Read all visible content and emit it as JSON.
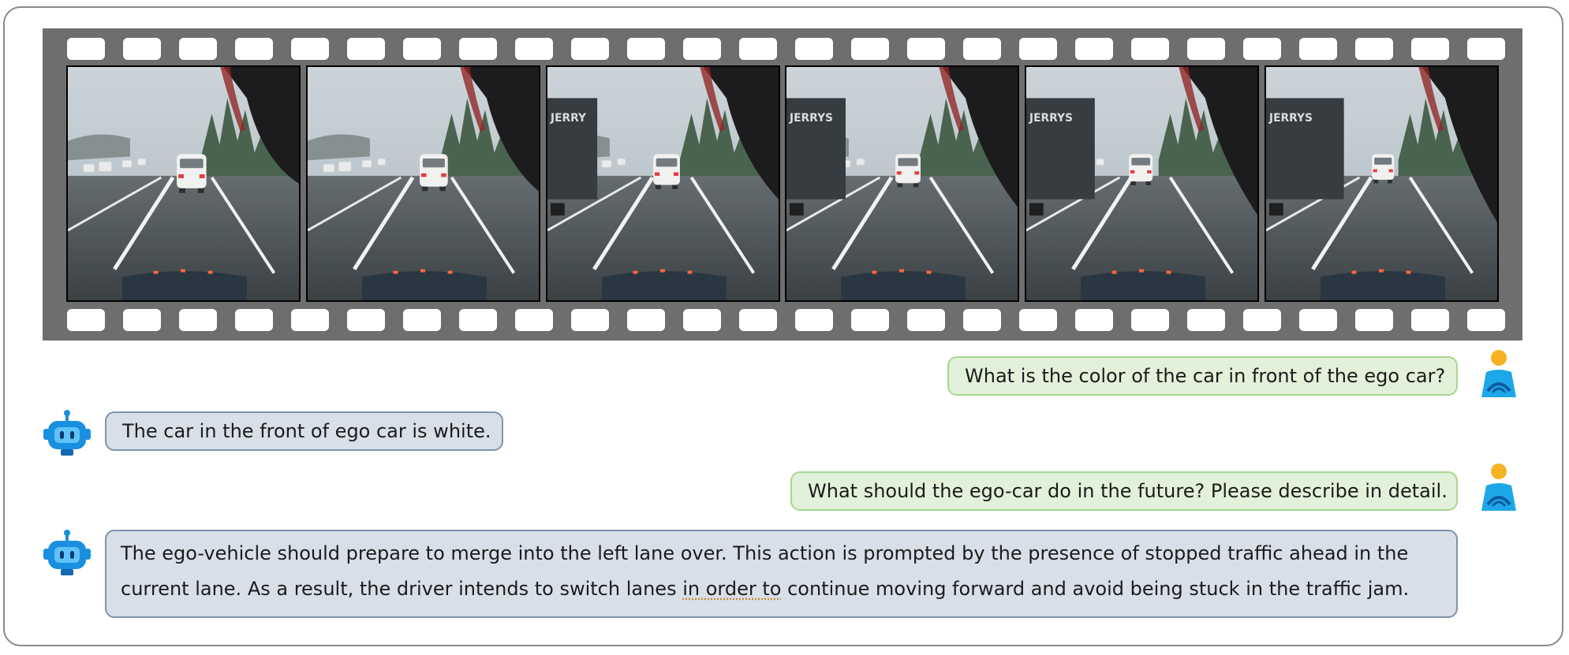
{
  "film": {
    "frame_count": 6,
    "frames": [
      {
        "alt": "dashcam-frame-1"
      },
      {
        "alt": "dashcam-frame-2"
      },
      {
        "alt": "dashcam-frame-3"
      },
      {
        "alt": "dashcam-frame-4"
      },
      {
        "alt": "dashcam-frame-5"
      },
      {
        "alt": "dashcam-frame-6"
      }
    ],
    "truck_text": "JERRYS"
  },
  "colors": {
    "user_bubble_bg": "#e2f1d9",
    "user_bubble_border": "#a7d78e",
    "bot_bubble_bg": "#d8dfe9",
    "bot_bubble_border": "#7e93ad",
    "user_avatar_head": "#f5b323",
    "user_avatar_body": "#1ea7e8",
    "bot_avatar": "#1a8fe0"
  },
  "chat": {
    "q1": "What is the color of the car in front of the ego car?",
    "a1": "The car in the front of ego car is white.",
    "q2": "What should the ego-car do in the future? Please describe in detail.",
    "a2_part1": "The ego-vehicle should prepare to merge into the left lane over. This action is prompted by the presence of stopped traffic ahead in the current lane. As a result, the driver intends to switch lanes ",
    "a2_link": "in order to",
    "a2_part2": " continue moving forward and avoid being stuck in the traffic jam."
  }
}
